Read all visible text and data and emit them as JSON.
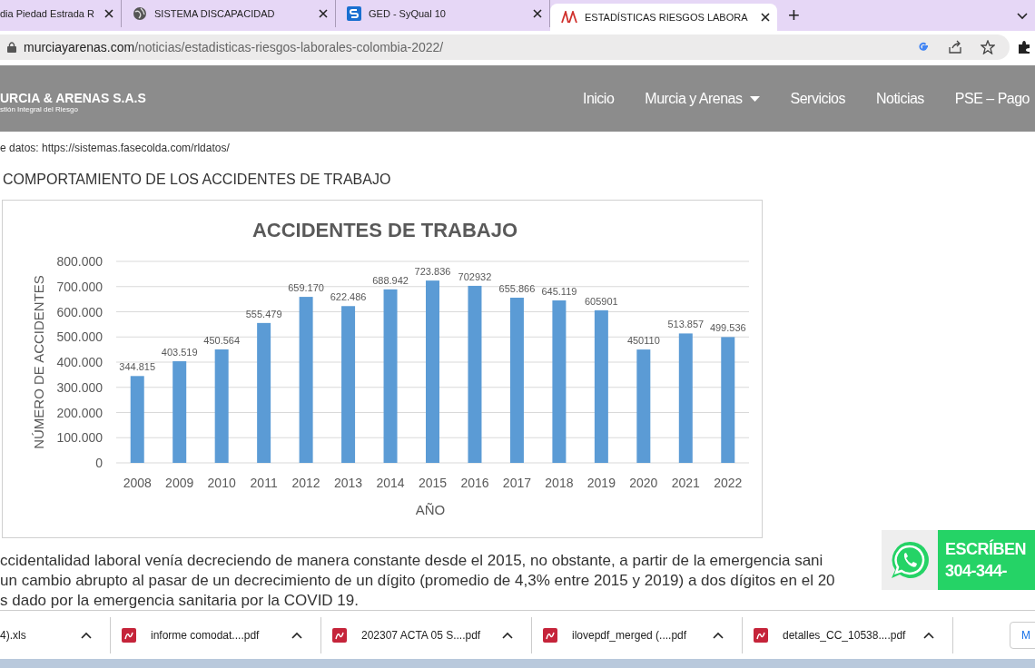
{
  "browser": {
    "tabs": [
      {
        "title": "dia Piedad Estrada R",
        "selected": false
      },
      {
        "title": "SISTEMA DISCAPACIDAD",
        "selected": false
      },
      {
        "title": "GED - SyQual 10",
        "selected": false
      },
      {
        "title": "ESTADÍSTICAS RIESGOS LABORA",
        "selected": true
      }
    ],
    "new_tab": "+",
    "url_host": "murciayarenas.com",
    "url_path": "/noticias/estadisticas-riesgos-laborales-colombia-2022/"
  },
  "site_header": {
    "logo": "URCIA & ARENAS S.A.S",
    "logo_tagline": "stión Integral del Riesgo",
    "nav": [
      {
        "label": "Inicio",
        "dropdown": false
      },
      {
        "label": "Murcia y Arenas",
        "dropdown": true
      },
      {
        "label": "Servicios",
        "dropdown": false
      },
      {
        "label": "Noticias",
        "dropdown": false
      },
      {
        "label": "PSE – Pago",
        "dropdown": false
      }
    ]
  },
  "content": {
    "source": "e datos: https://sistemas.fasecolda.com/rldatos/",
    "heading": "COMPORTAMIENTO DE LOS ACCIDENTES DE TRABAJO",
    "chart_data": {
      "type": "bar",
      "title": "ACCIDENTES DE TRABAJO",
      "xlabel": "AÑO",
      "ylabel": "NÚMERO DE ACCIDENTES",
      "categories": [
        "2008",
        "2009",
        "2010",
        "2011",
        "2012",
        "2013",
        "2014",
        "2015",
        "2016",
        "2017",
        "2018",
        "2019",
        "2020",
        "2021",
        "2022"
      ],
      "grid": true,
      "series": [
        {
          "color": "#5b9bd5",
          "values": [
            344815,
            403519,
            450564,
            555479,
            659170,
            622486,
            688942,
            723836,
            702932,
            655866,
            645119,
            605901,
            450110,
            513857,
            499536
          ]
        }
      ],
      "ylim": [
        0,
        800000
      ],
      "yticks": [
        {
          "value": 0,
          "label": "0"
        },
        {
          "value": 100000,
          "label": "100.000"
        },
        {
          "value": 200000,
          "label": "200.000"
        },
        {
          "value": 300000,
          "label": "300.000"
        },
        {
          "value": 400000,
          "label": "400.000"
        },
        {
          "value": 500000,
          "label": "500.000"
        },
        {
          "value": 600000,
          "label": "600.000"
        },
        {
          "value": 700000,
          "label": "700.000"
        },
        {
          "value": 800000,
          "label": "800.000"
        }
      ],
      "value_labels": [
        "344.815",
        "403.519",
        "450.564",
        "555.479",
        "659.170",
        "622.486",
        "688.942",
        "723.836",
        "702932",
        "655.866",
        "645.119",
        "605901",
        "450110",
        "513.857",
        "499.536"
      ]
    },
    "paragraph_lines": [
      "ccidentalidad laboral venía decreciendo de manera constante desde el 2015, no obstante, a partir de la emergencia sani",
      "un cambio abrupto al pasar de un decrecimiento de un dígito (promedio de 4,3% entre 2015 y 2019) a dos dígitos en el 20",
      "s dado por la emergencia sanitaria por la COVID 19."
    ]
  },
  "whatsapp": {
    "line_1": "ESCRÍBEN",
    "line_2": "304-344-"
  },
  "downloads": {
    "items": [
      "4).xls",
      "informe  comodat....pdf",
      "202307 ACTA 05 S....pdf",
      "ilovepdf_merged (....pdf",
      "detalles_CC_10538....pdf"
    ],
    "show_all": "M"
  }
}
